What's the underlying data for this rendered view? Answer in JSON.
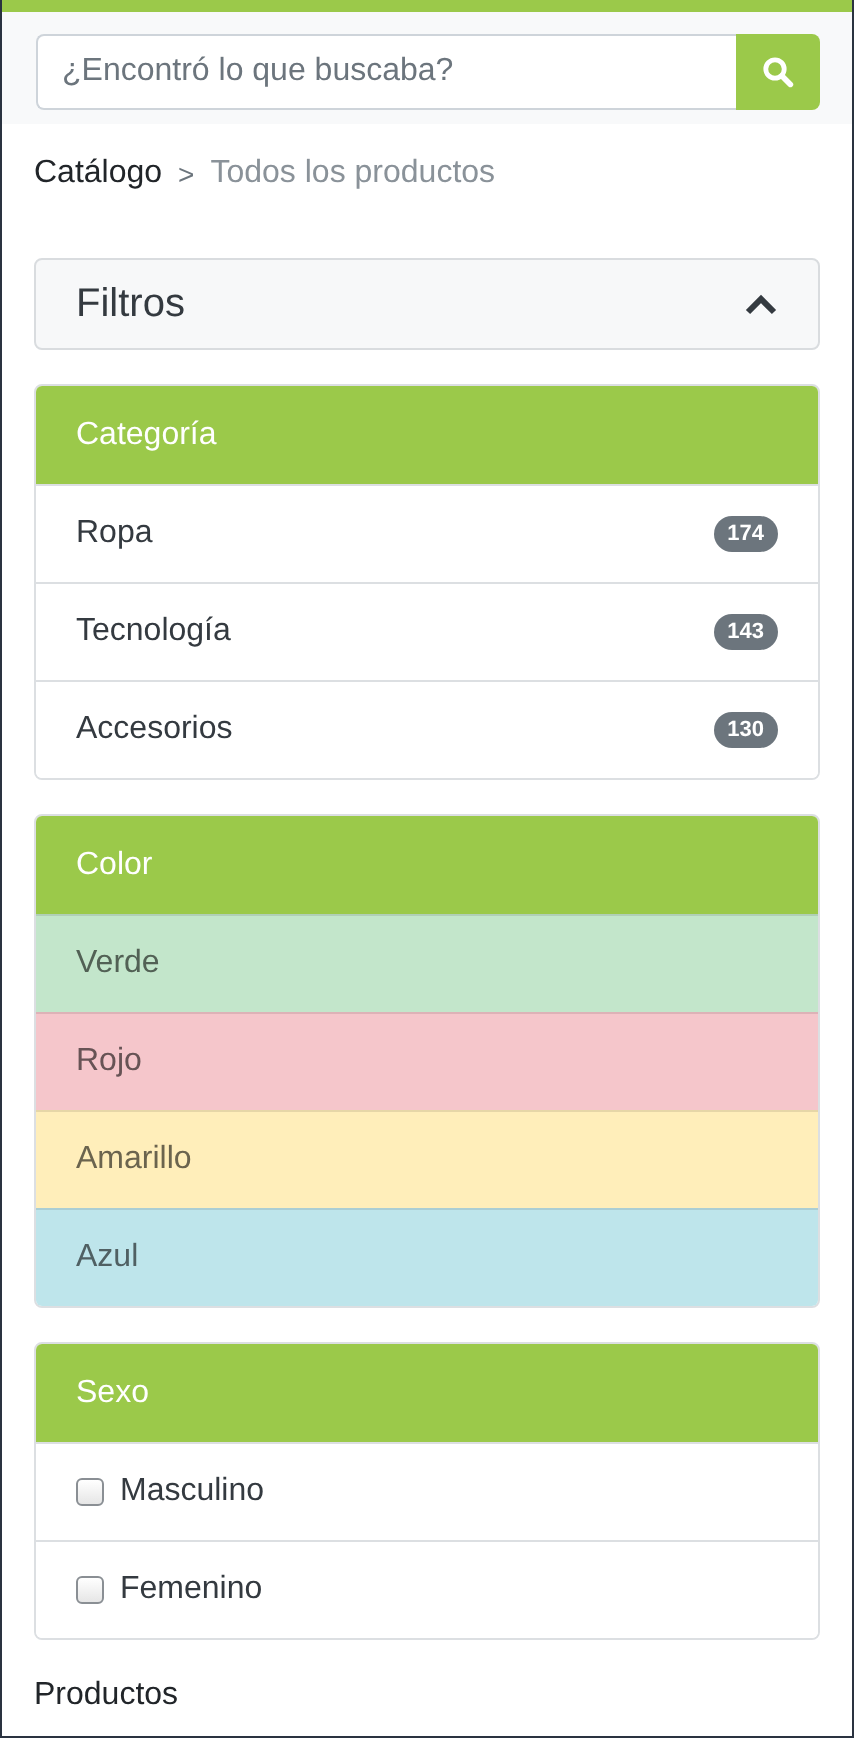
{
  "search": {
    "placeholder": "¿Encontró lo que buscaba?"
  },
  "breadcrumb": [
    {
      "label": "Catálogo",
      "current": false
    },
    {
      "label": "Todos los productos",
      "current": true
    }
  ],
  "breadcrumb_separator": ">",
  "filters": {
    "title": "Filtros",
    "expanded": true
  },
  "groups": [
    {
      "title": "Categoría",
      "kind": "counts",
      "items": [
        {
          "label": "Ropa",
          "count": "174"
        },
        {
          "label": "Tecnología",
          "count": "143"
        },
        {
          "label": "Accesorios",
          "count": "130"
        }
      ]
    },
    {
      "title": "Color",
      "kind": "colors",
      "items": [
        {
          "label": "Verde",
          "color": "#c3e6cb"
        },
        {
          "label": "Rojo",
          "color": "#f5c6cb"
        },
        {
          "label": "Amarillo",
          "color": "#ffeeba"
        },
        {
          "label": "Azul",
          "color": "#bee5eb"
        }
      ]
    },
    {
      "title": "Sexo",
      "kind": "checks",
      "items": [
        {
          "label": "Masculino",
          "checked": false
        },
        {
          "label": "Femenino",
          "checked": false
        }
      ]
    }
  ],
  "section_title": "Productos"
}
